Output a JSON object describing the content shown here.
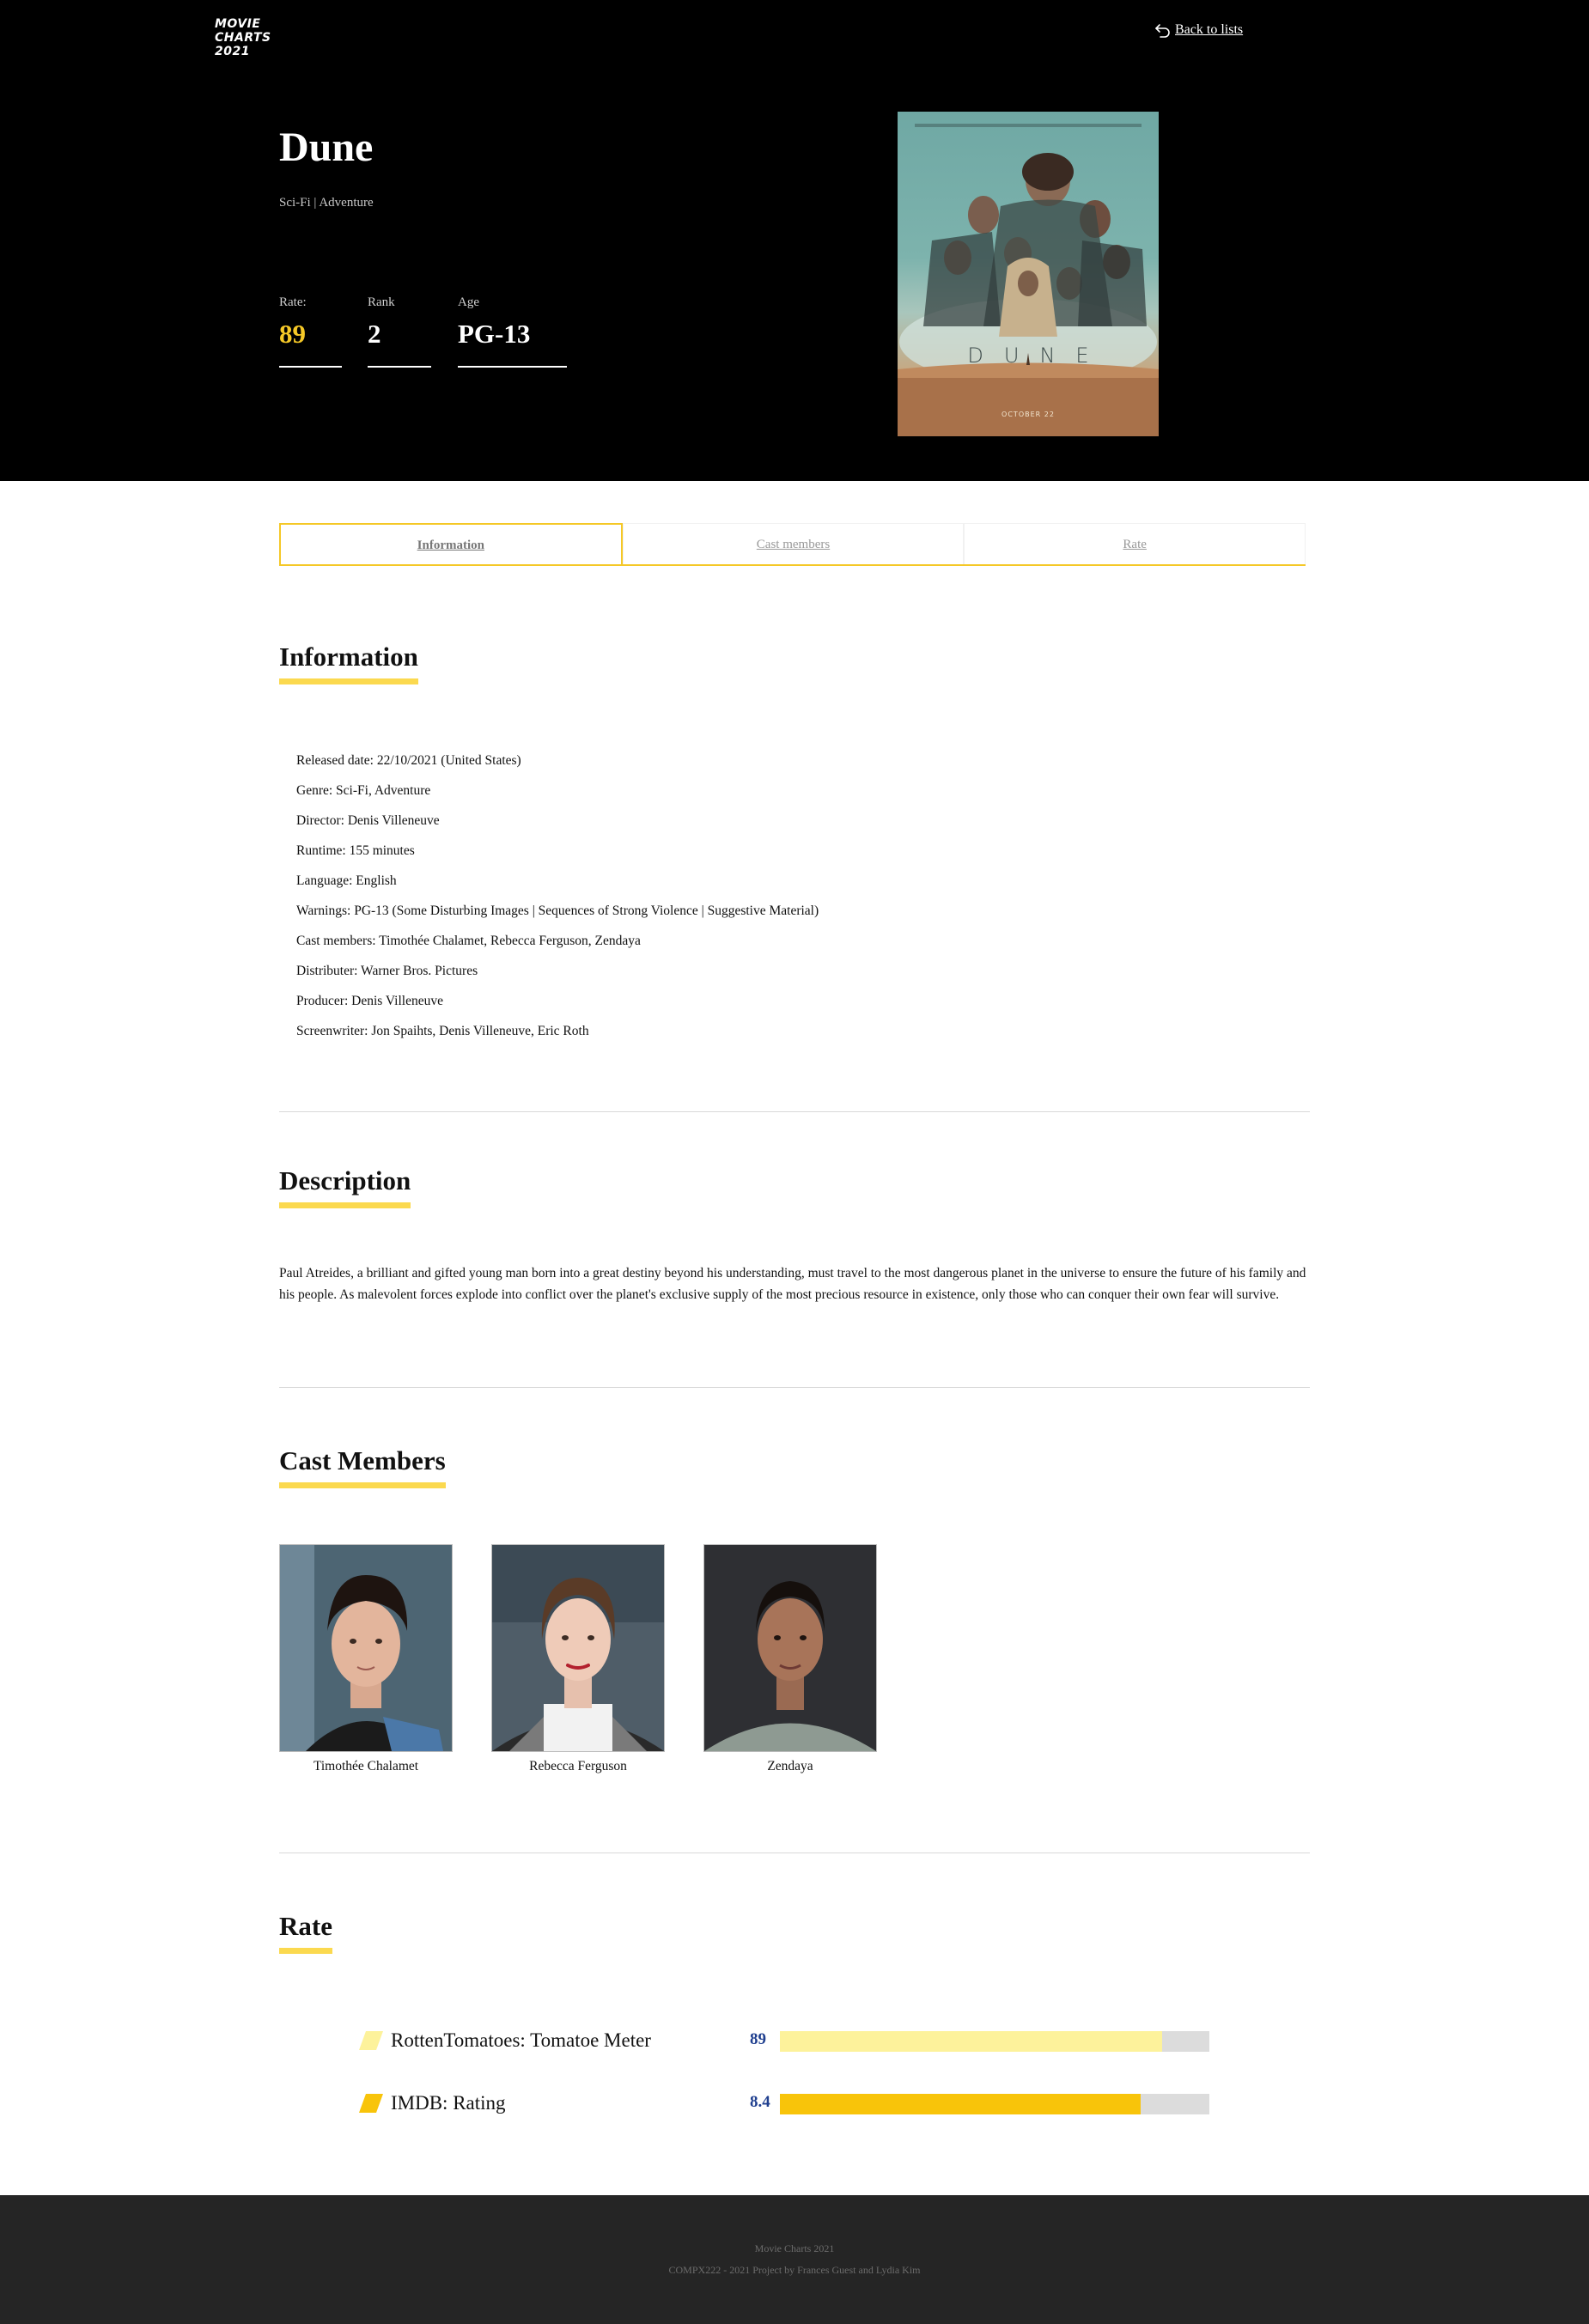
{
  "header": {
    "logo_lines": [
      "MOVIE",
      "CHARTS",
      "2021"
    ],
    "back_link": "Back to lists"
  },
  "movie": {
    "title": "Dune",
    "genre": "Sci-Fi | Adventure",
    "stats": {
      "rate_label": "Rate:",
      "rate_value": "89",
      "rank_label": "Rank",
      "rank_value": "2",
      "age_label": "Age",
      "age_value": "PG-13"
    },
    "poster": {
      "wordmark": "DUNE",
      "date": "OCTOBER 22"
    }
  },
  "tabs": [
    {
      "label": "Information",
      "active": true
    },
    {
      "label": "Cast members",
      "active": false
    },
    {
      "label": "Rate",
      "active": false
    }
  ],
  "information": {
    "title": "Information",
    "items": [
      "Released date: 22/10/2021 (United States)",
      "Genre: Sci-Fi, Adventure",
      "Director: Denis Villeneuve",
      "Runtime: 155 minutes",
      "Language: English",
      "Warnings: PG-13 (Some Disturbing Images | Sequences of Strong Violence | Suggestive Material)",
      "Cast members: Timothée Chalamet, Rebecca Ferguson, Zendaya",
      "Distributer: Warner Bros. Pictures",
      "Producer: Denis Villeneuve",
      "Screenwriter: Jon Spaihts, Denis Villeneuve, Eric Roth"
    ]
  },
  "description": {
    "title": "Description",
    "text": "Paul Atreides, a brilliant and gifted young man born into a great destiny beyond his understanding, must travel to the most dangerous planet in the universe to ensure the future of his family and his people. As malevolent forces explode into conflict over the planet's exclusive supply of the most precious resource in existence, only those who can conquer their own fear will survive."
  },
  "cast": {
    "title": "Cast Members",
    "members": [
      {
        "name": "Timothée Chalamet"
      },
      {
        "name": "Rebecca Ferguson"
      },
      {
        "name": "Zendaya"
      }
    ]
  },
  "rate": {
    "title": "Rate",
    "rows": [
      {
        "label": "RottenTomatoes: Tomatoe Meter",
        "value": "89",
        "fraction": 0.89,
        "color": "#fdf29b"
      },
      {
        "label": "IMDB: Rating",
        "value": "8.4",
        "fraction": 0.84,
        "color": "#f8c40a"
      }
    ]
  },
  "footer": {
    "line1": "Movie Charts 2021",
    "line2": "COMPX222 - 2021 Project by Frances Guest and Lydia Kim"
  },
  "colors": {
    "accent_yellow": "#f5c827",
    "underline_yellow": "#fbd94f",
    "rate_value_blue": "#1f3f8f",
    "hero_bg": "#000000",
    "footer_bg": "#252525"
  }
}
